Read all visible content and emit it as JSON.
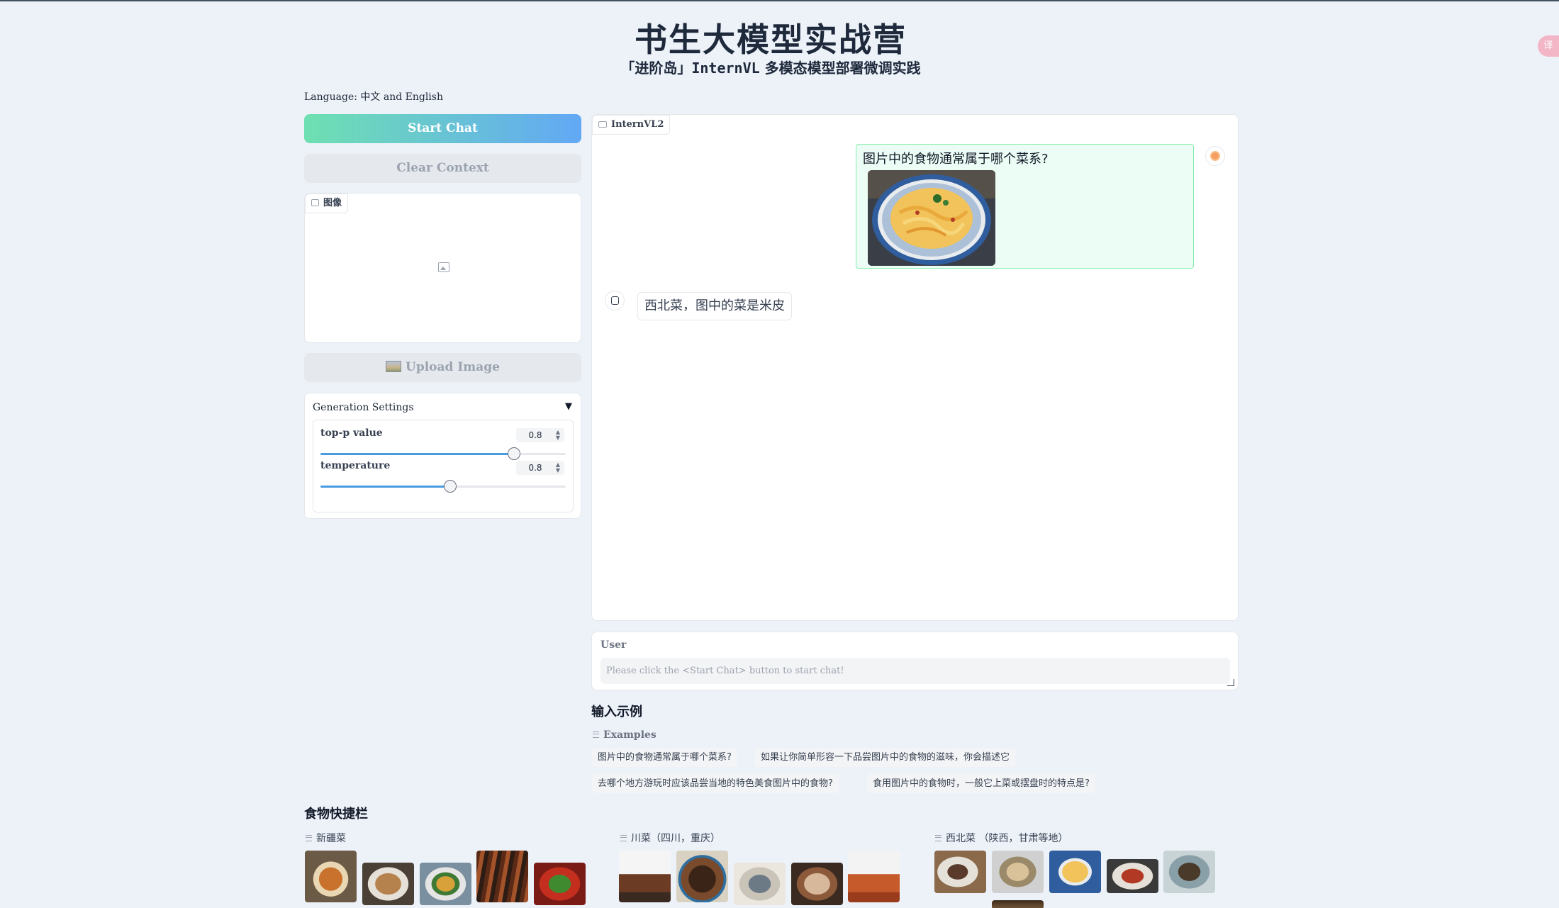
{
  "header": {
    "title": "书生大模型实战营",
    "subtitle_prefix": "「进阶岛」",
    "subtitle_mono": "InternVL",
    "subtitle_suffix": " 多模态模型部署微调实践",
    "translate_badge": "译"
  },
  "language_label": "Language: 中文 and English",
  "buttons": {
    "start_chat": "Start Chat",
    "clear_context": "Clear Context",
    "upload_image": "Upload Image"
  },
  "image_panel": {
    "label": "图像"
  },
  "generation_settings": {
    "title": "Generation Settings",
    "caret": "▼",
    "sliders": [
      {
        "label": "top-p value",
        "value": "0.8",
        "fraction": 0.79
      },
      {
        "label": "temperature",
        "value": "0.8",
        "fraction": 0.53
      }
    ]
  },
  "chat": {
    "label": "InternVL2",
    "user_message": "图片中的食物通常属于哪个菜系?",
    "bot_message": "西北菜，图中的菜是米皮"
  },
  "user_input": {
    "label": "User",
    "placeholder": "Please click the <Start Chat> button to start chat!"
  },
  "examples": {
    "section_title": "输入示例",
    "label": "Examples",
    "items": [
      "图片中的食物通常属于哪个菜系?",
      "如果让你简单形容一下品尝图片中的食物的滋味，你会描述它",
      "去哪个地方游玩时应该品尝当地的特色美食图片中的食物?",
      "食用图片中的食物时，一般它上菜或摆盘时的特点是?"
    ]
  },
  "food_bar": {
    "title": "食物快捷栏",
    "categories": [
      {
        "label": "新疆菜"
      },
      {
        "label": "川菜（四川，重庆）"
      },
      {
        "label": "西北菜 （陕西，甘肃等地）"
      }
    ]
  },
  "colors": {
    "start_gradient_from": "#6ee0b1",
    "start_gradient_to": "#62a8f5",
    "user_bubble_bg": "#ecfdf5",
    "user_bubble_border": "#86efac",
    "slider_fill": "#4a9ce0"
  }
}
